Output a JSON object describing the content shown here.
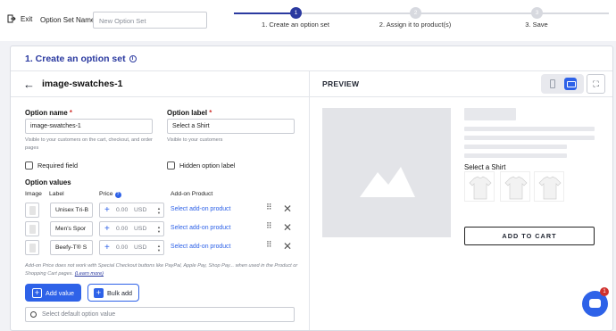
{
  "header": {
    "exit_label": "Exit",
    "option_set_name_label": "Option Set Name",
    "option_set_name_placeholder": "New Option Set"
  },
  "stepper": {
    "steps": [
      {
        "num": "1",
        "label": "1. Create an option set"
      },
      {
        "num": "2",
        "label": "2. Assign it to product(s)"
      },
      {
        "num": "3",
        "label": "3. Save"
      }
    ],
    "active_step": 1
  },
  "section": {
    "title": "1. Create an option set"
  },
  "editor": {
    "option_title": "image-swatches-1",
    "option_name_label": "Option name",
    "option_name_value": "image-swatches-1",
    "option_name_help": "Visible to your customers on the cart, checkout, and order pages",
    "option_label_label": "Option label",
    "option_label_value": "Select a Shirt",
    "option_label_help": "Visible to your customers",
    "required_field": "Required field",
    "hidden_option_label": "Hidden option label",
    "option_values_title": "Option values",
    "columns": {
      "image": "Image",
      "label": "Label",
      "price": "Price",
      "addon": "Add-on Product"
    },
    "values": [
      {
        "label": "Unisex Tri-B",
        "price": "0.00",
        "currency": "USD",
        "addon": "Select add-on product"
      },
      {
        "label": "Men's Spor",
        "price": "0.00",
        "currency": "USD",
        "addon": "Select add-on product"
      },
      {
        "label": "Beefy-T® S",
        "price": "0.00",
        "currency": "USD",
        "addon": "Select add-on product"
      }
    ],
    "note": "Add-on Price does not work with Special Checkout buttons like PayPal, Apple Pay, Shop Pay... when used in the Product or Shopping Cart pages.",
    "note_link": "(Learn more)",
    "add_value": "Add value",
    "bulk_add": "Bulk add",
    "default_placeholder": "Select default option value"
  },
  "preview": {
    "title": "PREVIEW",
    "select_label": "Select a Shirt",
    "add_to_cart": "ADD TO CART"
  },
  "chat": {
    "badge": "1"
  },
  "colors": {
    "accent": "#2e62e8",
    "title": "#2b3aa0",
    "required": "#d0312d"
  }
}
